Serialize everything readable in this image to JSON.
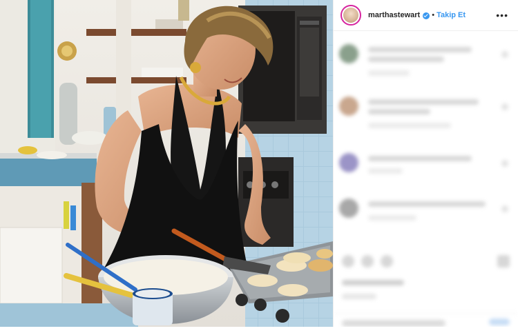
{
  "post": {
    "username": "marthastewart",
    "separator": "•",
    "follow_label": "Takip Et",
    "more_label": "•••"
  },
  "colors": {
    "accent": "#3897f0",
    "story_ring": "#d6249f",
    "text": "#262626"
  },
  "icons": {
    "verified": "verified-badge-icon",
    "more": "more-options-icon"
  }
}
